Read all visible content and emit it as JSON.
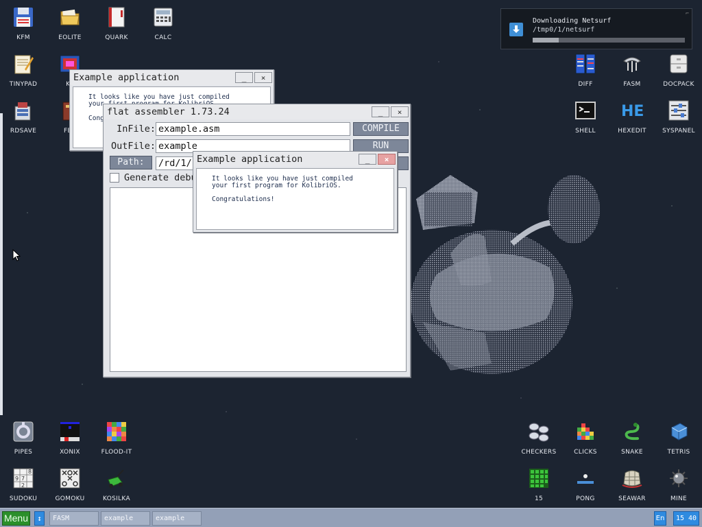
{
  "desktop_icons": [
    {
      "label": "KFM",
      "icon": "floppy-disk-icon"
    },
    {
      "label": "EOLITE",
      "icon": "folder-icon"
    },
    {
      "label": "QUARK",
      "icon": "notebook-icon"
    },
    {
      "label": "CALC",
      "icon": "calculator-icon"
    },
    {
      "label": "TINYPAD",
      "icon": "notepad-icon"
    },
    {
      "label": "KF",
      "icon": "font-editor-icon"
    },
    {
      "label": "RDSAVE",
      "icon": "ramdisk-save-icon"
    },
    {
      "label": "FB2",
      "icon": "book-reader-icon"
    },
    {
      "label": "DIFF",
      "icon": "diff-icon"
    },
    {
      "label": "FASM",
      "icon": "fasm-icon"
    },
    {
      "label": "DOCPACK",
      "icon": "docpack-icon"
    },
    {
      "label": "SHELL",
      "icon": "terminal-icon"
    },
    {
      "label": "HEXEDIT",
      "icon": "hex-editor-icon"
    },
    {
      "label": "SYSPANEL",
      "icon": "sliders-icon"
    },
    {
      "label": "PIPES",
      "icon": "pipes-icon"
    },
    {
      "label": "XONIX",
      "icon": "xonix-icon"
    },
    {
      "label": "FLOOD-IT",
      "icon": "flood-it-icon"
    },
    {
      "label": "SUDOKU",
      "icon": "sudoku-icon"
    },
    {
      "label": "GOMOKU",
      "icon": "gomoku-icon"
    },
    {
      "label": "KOSILKA",
      "icon": "lawn-mower-icon"
    },
    {
      "label": "CHECKERS",
      "icon": "checkers-icon"
    },
    {
      "label": "CLICKS",
      "icon": "clicks-icon"
    },
    {
      "label": "SNAKE",
      "icon": "snake-icon"
    },
    {
      "label": "TETRIS",
      "icon": "tetris-icon"
    },
    {
      "label": "15",
      "icon": "fifteen-puzzle-icon"
    },
    {
      "label": "PONG",
      "icon": "pong-icon"
    },
    {
      "label": "SEAWAR",
      "icon": "seawar-icon"
    },
    {
      "label": "MINE",
      "icon": "mine-icon"
    }
  ],
  "example_back": {
    "title": "Example application",
    "line1": "It looks like you have just compiled",
    "line2": "your first program for KolibriOS.",
    "line3": "Cong"
  },
  "fasm": {
    "title": "flat assembler 1.73.24",
    "infile_label": "InFile:",
    "infile_value": "example.asm",
    "outfile_label": "OutFile:",
    "outfile_value": "example",
    "path_label": "Path:",
    "path_value": "/rd/1/",
    "compile_label": "COMPILE",
    "run_label": "RUN",
    "debug_label": "Generate debu",
    "debug_checked": false
  },
  "example_front": {
    "title": "Example application",
    "line1": "It looks like you have just compiled",
    "line2": "your first program for KolibriOS.",
    "line3": "Congratulations!"
  },
  "window_controls": {
    "minimize": "_",
    "close": "×"
  },
  "notification": {
    "title": "Downloading Netsurf",
    "path": "/tmp0/1/netsurf",
    "progress": 0.17,
    "icon": "download-arrow-icon"
  },
  "taskbar": {
    "menu_label": "Menu",
    "swap_symbol": "↕",
    "tasks": [
      "FASM",
      "example",
      "example"
    ],
    "lang": "En",
    "clock": "15 40"
  },
  "colors": {
    "desktop_bg": "#1c2431",
    "taskbar": "#93a0b7",
    "menu_green": "#2b8f2b",
    "accent_blue": "#2f8be0",
    "close_red": "#e7a2a2"
  }
}
